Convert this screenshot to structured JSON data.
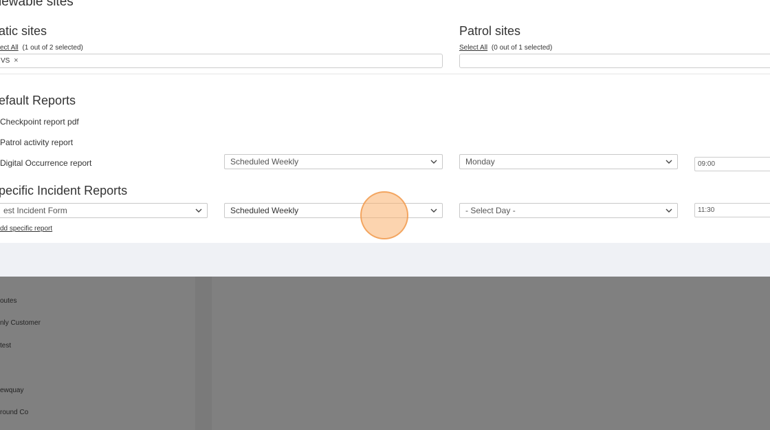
{
  "viewable_sites": {
    "title": "iewable sites"
  },
  "static_sites": {
    "title": "atic sites",
    "select_all": "ect All",
    "selection_count": "(1 out of 2 selected)",
    "selected_tag": "VS",
    "remove_icon": "close-icon"
  },
  "patrol_sites": {
    "title": "Patrol sites",
    "select_all": "Select All",
    "selection_count": "(0 out of 1 selected)"
  },
  "default_reports": {
    "title": "efault Reports",
    "items": [
      {
        "label": "Checkpoint report pdf"
      },
      {
        "label": "Patrol activity report"
      },
      {
        "label": "Digital Occurrence report",
        "frequency": "Scheduled Weekly",
        "day": "Monday",
        "time": "09:00"
      }
    ]
  },
  "specific_reports": {
    "title": "pecific Incident Reports",
    "form": "est Incident Form",
    "frequency": "Scheduled Weekly",
    "day": "- Select Day -",
    "time": "11:30",
    "add_link": "dd specific report"
  },
  "sidebar": {
    "items": [
      {
        "label": "outes"
      },
      {
        "label": "nly Customer"
      },
      {
        "label": " test"
      },
      {
        "label": "ewquay"
      },
      {
        "label": "round Co"
      }
    ]
  },
  "icons": {
    "dropdown": "chevron-down-icon"
  },
  "colors": {
    "overlay": "#808080",
    "footer_band": "#eff1f5",
    "click_marker": "#f5a35c"
  }
}
